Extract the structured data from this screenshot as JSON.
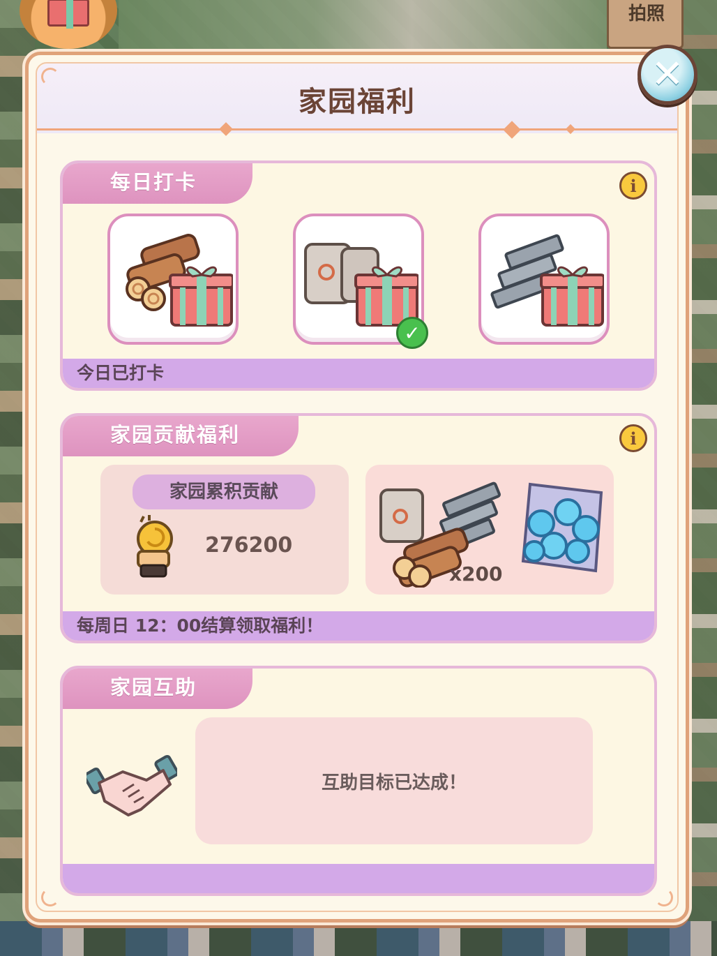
{
  "background": {
    "top_right_label": "拍照"
  },
  "panel": {
    "title": "家园福利",
    "close_icon": "close-icon"
  },
  "daily_checkin": {
    "header": "每日打卡",
    "info_icon": "info-icon",
    "items": [
      {
        "name": "wood-gift",
        "checked": false
      },
      {
        "name": "cement-gift",
        "checked": true
      },
      {
        "name": "steel-gift",
        "checked": false
      }
    ],
    "status": "今日已打卡"
  },
  "contribution": {
    "header": "家园贡献福利",
    "info_icon": "info-icon",
    "label": "家园累积贡献",
    "value": "276200",
    "reward_qty": "x200",
    "footer": "每周日 12：00结算领取福利！"
  },
  "mutual_help": {
    "header": "家园互助",
    "status": "互助目标已达成！"
  },
  "colors": {
    "panel_bg": "#fdf8ea",
    "panel_border": "#dfa27a",
    "section_header": "#de93bf",
    "section_footer": "#d3a9e8",
    "title_text": "#6b4436"
  }
}
